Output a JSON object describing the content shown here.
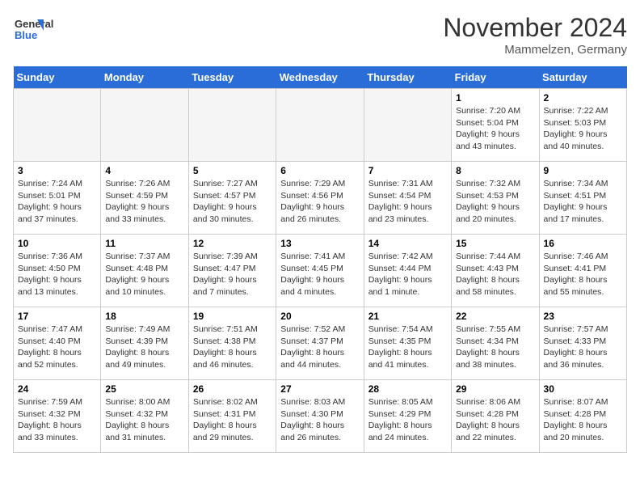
{
  "header": {
    "logo_general": "General",
    "logo_blue": "Blue",
    "title": "November 2024",
    "location": "Mammelzen, Germany"
  },
  "weekdays": [
    "Sunday",
    "Monday",
    "Tuesday",
    "Wednesday",
    "Thursday",
    "Friday",
    "Saturday"
  ],
  "weeks": [
    [
      {
        "day": "",
        "detail": ""
      },
      {
        "day": "",
        "detail": ""
      },
      {
        "day": "",
        "detail": ""
      },
      {
        "day": "",
        "detail": ""
      },
      {
        "day": "",
        "detail": ""
      },
      {
        "day": "1",
        "detail": "Sunrise: 7:20 AM\nSunset: 5:04 PM\nDaylight: 9 hours\nand 43 minutes."
      },
      {
        "day": "2",
        "detail": "Sunrise: 7:22 AM\nSunset: 5:03 PM\nDaylight: 9 hours\nand 40 minutes."
      }
    ],
    [
      {
        "day": "3",
        "detail": "Sunrise: 7:24 AM\nSunset: 5:01 PM\nDaylight: 9 hours\nand 37 minutes."
      },
      {
        "day": "4",
        "detail": "Sunrise: 7:26 AM\nSunset: 4:59 PM\nDaylight: 9 hours\nand 33 minutes."
      },
      {
        "day": "5",
        "detail": "Sunrise: 7:27 AM\nSunset: 4:57 PM\nDaylight: 9 hours\nand 30 minutes."
      },
      {
        "day": "6",
        "detail": "Sunrise: 7:29 AM\nSunset: 4:56 PM\nDaylight: 9 hours\nand 26 minutes."
      },
      {
        "day": "7",
        "detail": "Sunrise: 7:31 AM\nSunset: 4:54 PM\nDaylight: 9 hours\nand 23 minutes."
      },
      {
        "day": "8",
        "detail": "Sunrise: 7:32 AM\nSunset: 4:53 PM\nDaylight: 9 hours\nand 20 minutes."
      },
      {
        "day": "9",
        "detail": "Sunrise: 7:34 AM\nSunset: 4:51 PM\nDaylight: 9 hours\nand 17 minutes."
      }
    ],
    [
      {
        "day": "10",
        "detail": "Sunrise: 7:36 AM\nSunset: 4:50 PM\nDaylight: 9 hours\nand 13 minutes."
      },
      {
        "day": "11",
        "detail": "Sunrise: 7:37 AM\nSunset: 4:48 PM\nDaylight: 9 hours\nand 10 minutes."
      },
      {
        "day": "12",
        "detail": "Sunrise: 7:39 AM\nSunset: 4:47 PM\nDaylight: 9 hours\nand 7 minutes."
      },
      {
        "day": "13",
        "detail": "Sunrise: 7:41 AM\nSunset: 4:45 PM\nDaylight: 9 hours\nand 4 minutes."
      },
      {
        "day": "14",
        "detail": "Sunrise: 7:42 AM\nSunset: 4:44 PM\nDaylight: 9 hours\nand 1 minute."
      },
      {
        "day": "15",
        "detail": "Sunrise: 7:44 AM\nSunset: 4:43 PM\nDaylight: 8 hours\nand 58 minutes."
      },
      {
        "day": "16",
        "detail": "Sunrise: 7:46 AM\nSunset: 4:41 PM\nDaylight: 8 hours\nand 55 minutes."
      }
    ],
    [
      {
        "day": "17",
        "detail": "Sunrise: 7:47 AM\nSunset: 4:40 PM\nDaylight: 8 hours\nand 52 minutes."
      },
      {
        "day": "18",
        "detail": "Sunrise: 7:49 AM\nSunset: 4:39 PM\nDaylight: 8 hours\nand 49 minutes."
      },
      {
        "day": "19",
        "detail": "Sunrise: 7:51 AM\nSunset: 4:38 PM\nDaylight: 8 hours\nand 46 minutes."
      },
      {
        "day": "20",
        "detail": "Sunrise: 7:52 AM\nSunset: 4:37 PM\nDaylight: 8 hours\nand 44 minutes."
      },
      {
        "day": "21",
        "detail": "Sunrise: 7:54 AM\nSunset: 4:35 PM\nDaylight: 8 hours\nand 41 minutes."
      },
      {
        "day": "22",
        "detail": "Sunrise: 7:55 AM\nSunset: 4:34 PM\nDaylight: 8 hours\nand 38 minutes."
      },
      {
        "day": "23",
        "detail": "Sunrise: 7:57 AM\nSunset: 4:33 PM\nDaylight: 8 hours\nand 36 minutes."
      }
    ],
    [
      {
        "day": "24",
        "detail": "Sunrise: 7:59 AM\nSunset: 4:32 PM\nDaylight: 8 hours\nand 33 minutes."
      },
      {
        "day": "25",
        "detail": "Sunrise: 8:00 AM\nSunset: 4:32 PM\nDaylight: 8 hours\nand 31 minutes."
      },
      {
        "day": "26",
        "detail": "Sunrise: 8:02 AM\nSunset: 4:31 PM\nDaylight: 8 hours\nand 29 minutes."
      },
      {
        "day": "27",
        "detail": "Sunrise: 8:03 AM\nSunset: 4:30 PM\nDaylight: 8 hours\nand 26 minutes."
      },
      {
        "day": "28",
        "detail": "Sunrise: 8:05 AM\nSunset: 4:29 PM\nDaylight: 8 hours\nand 24 minutes."
      },
      {
        "day": "29",
        "detail": "Sunrise: 8:06 AM\nSunset: 4:28 PM\nDaylight: 8 hours\nand 22 minutes."
      },
      {
        "day": "30",
        "detail": "Sunrise: 8:07 AM\nSunset: 4:28 PM\nDaylight: 8 hours\nand 20 minutes."
      }
    ]
  ]
}
